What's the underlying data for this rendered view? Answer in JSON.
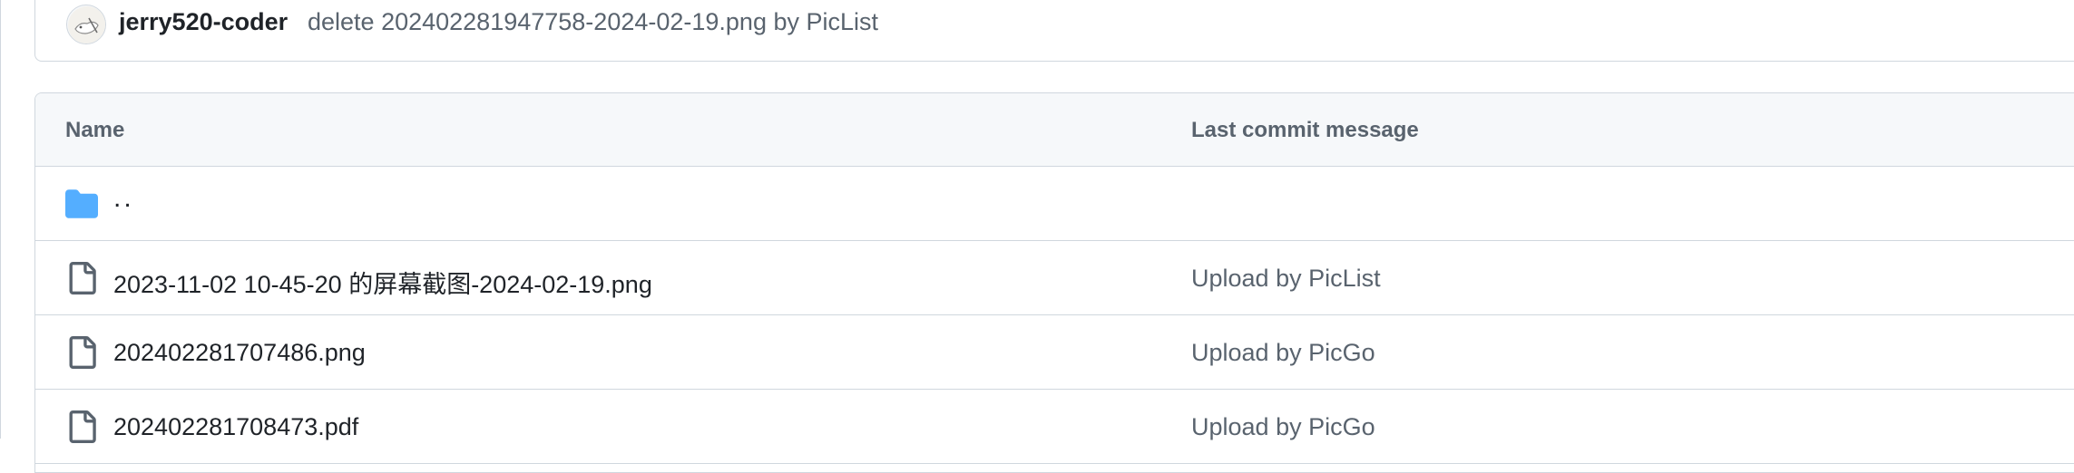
{
  "latest_commit": {
    "author": "jerry520-coder",
    "message": "delete 202402281947758-2024-02-19.png by PicList",
    "avatar_icon": "avatar"
  },
  "file_table": {
    "headers": {
      "name": "Name",
      "last_commit_message": "Last commit message"
    },
    "parent_row": {
      "label": "..",
      "icon": "folder-icon"
    },
    "rows": [
      {
        "name": "2023-11-02 10-45-20 的屏幕截图-2024-02-19.png",
        "message": "Upload by PicList",
        "icon": "file-icon"
      },
      {
        "name": "202402281707486.png",
        "message": "Upload by PicGo",
        "icon": "file-icon"
      },
      {
        "name": "202402281708473.pdf",
        "message": "Upload by PicGo",
        "icon": "file-icon"
      }
    ]
  },
  "colors": {
    "folder": "#54aeff",
    "border": "#d0d7de",
    "header_bg": "#f6f8fa",
    "muted_text": "#59636e",
    "text": "#1f2328"
  }
}
